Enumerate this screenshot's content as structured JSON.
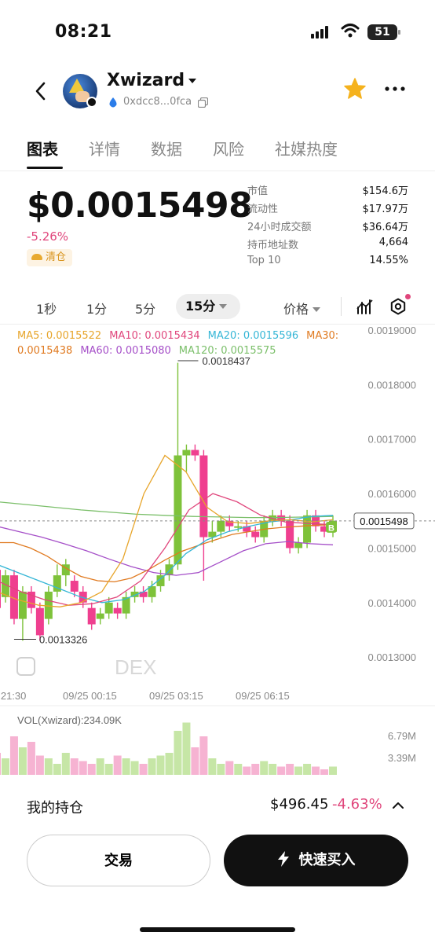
{
  "status_bar": {
    "time": "08:21",
    "battery": "51"
  },
  "header": {
    "token_name": "Xwizard",
    "address": "0xdcc8...0fca"
  },
  "tabs": [
    "图表",
    "详情",
    "数据",
    "风险",
    "社媒热度"
  ],
  "price_section": {
    "price": "$0.0015498",
    "change": "-5.26%",
    "tag": "清仓"
  },
  "stats": [
    {
      "k": "市值",
      "v": "$154.6万"
    },
    {
      "k": "流动性",
      "v": "$17.97万"
    },
    {
      "k": "24小时成交额",
      "v": "$36.64万"
    },
    {
      "k": "持币地址数",
      "v": "4,664"
    },
    {
      "k": "Top 10",
      "v": "14.55%"
    }
  ],
  "intervals": [
    "1秒",
    "1分",
    "5分",
    "15分"
  ],
  "active_interval": "15分",
  "price_type": "价格",
  "ma_legend": {
    "ma5": "MA5: 0.0015522",
    "ma10": "MA10: 0.0015434",
    "ma20": "MA20: 0.0015596",
    "ma30": "MA30:",
    "ma30_val": "0.0015438",
    "ma60": "MA60: 0.0015080",
    "ma120": "MA120: 0.0015575"
  },
  "colors": {
    "up": "#7ec23a",
    "down": "#ef3f8f",
    "ma5": "#e7a52b",
    "ma10": "#e0467c",
    "ma20": "#35b6d6",
    "ma30": "#e07a20",
    "ma60": "#a54fc8",
    "ma120": "#7bbf6a"
  },
  "chart_data": {
    "type": "candlestick",
    "y_ticks": [
      "0.0019000",
      "0.0018000",
      "0.0017000",
      "0.0016000",
      "0.0015000",
      "0.0014000",
      "0.0013000"
    ],
    "y_range": [
      0.00128,
      0.0019
    ],
    "x_ticks": [
      "4 21:30",
      "09/25 00:15",
      "09/25 03:15",
      "09/25 06:15"
    ],
    "high_label": "0.0018437",
    "low_label": "0.0013326",
    "current_price_label": "0.0015498",
    "watermark": "DEX",
    "candles": [
      [
        0.00146,
        0.00139,
        0.00147,
        0.00137
      ],
      [
        0.00141,
        0.00145,
        0.00146,
        0.0014
      ],
      [
        0.00145,
        0.00137,
        0.00146,
        0.00136
      ],
      [
        0.00137,
        0.00142,
        0.00143,
        0.00133
      ],
      [
        0.00142,
        0.00139,
        0.00143,
        0.00138
      ],
      [
        0.00139,
        0.00134,
        0.0014,
        0.00133
      ],
      [
        0.00137,
        0.00142,
        0.00143,
        0.00136
      ],
      [
        0.00142,
        0.00145,
        0.00147,
        0.00141
      ],
      [
        0.00145,
        0.00147,
        0.00148,
        0.00143
      ],
      [
        0.00144,
        0.00142,
        0.00145,
        0.00141
      ],
      [
        0.00142,
        0.0014,
        0.00143,
        0.00139
      ],
      [
        0.00139,
        0.00136,
        0.0014,
        0.00135
      ],
      [
        0.00137,
        0.00138,
        0.00139,
        0.00136
      ],
      [
        0.00138,
        0.0014,
        0.00141,
        0.00137
      ],
      [
        0.00139,
        0.00138,
        0.0014,
        0.00137
      ],
      [
        0.00138,
        0.00141,
        0.00142,
        0.00137
      ],
      [
        0.00141,
        0.00142,
        0.00143,
        0.0014
      ],
      [
        0.00142,
        0.00141,
        0.00143,
        0.0014
      ],
      [
        0.00141,
        0.00143,
        0.00144,
        0.0014
      ],
      [
        0.00143,
        0.00145,
        0.00146,
        0.00142
      ],
      [
        0.00145,
        0.00147,
        0.00148,
        0.00144
      ],
      [
        0.00147,
        0.00167,
        0.00184,
        0.00146
      ],
      [
        0.00167,
        0.00168,
        0.00169,
        0.00164
      ],
      [
        0.00168,
        0.00167,
        0.00169,
        0.00166
      ],
      [
        0.00167,
        0.00152,
        0.00168,
        0.00144
      ],
      [
        0.00152,
        0.00153,
        0.00155,
        0.00151
      ],
      [
        0.00153,
        0.00155,
        0.00156,
        0.00152
      ],
      [
        0.00155,
        0.00154,
        0.00156,
        0.00153
      ],
      [
        0.00154,
        0.00154,
        0.00155,
        0.00153
      ],
      [
        0.00154,
        0.00153,
        0.00155,
        0.00152
      ],
      [
        0.00153,
        0.00152,
        0.00154,
        0.00151
      ],
      [
        0.00152,
        0.00155,
        0.00156,
        0.00151
      ],
      [
        0.00155,
        0.00156,
        0.00157,
        0.00154
      ],
      [
        0.00156,
        0.00155,
        0.00157,
        0.00154
      ],
      [
        0.00155,
        0.0015,
        0.00156,
        0.00149
      ],
      [
        0.0015,
        0.00151,
        0.00152,
        0.00149
      ],
      [
        0.00151,
        0.00156,
        0.00157,
        0.0015
      ],
      [
        0.00156,
        0.00154,
        0.00157,
        0.00153
      ],
      [
        0.00154,
        0.00153,
        0.00155,
        0.00152
      ],
      [
        0.00153,
        0.00155,
        0.00156,
        0.00152
      ]
    ],
    "ma120": [
      0.001585,
      0.00158,
      0.001575,
      0.00157,
      0.001566,
      0.001562,
      0.00156,
      0.001558,
      0.001557,
      0.001556,
      0.001556,
      0.001557,
      0.001558
    ],
    "ma60": [
      0.00154,
      0.00153,
      0.00152,
      0.001508,
      0.001495,
      0.00148,
      0.001466,
      0.001455,
      0.00145,
      0.001455,
      0.001475,
      0.001495,
      0.001508,
      0.001512,
      0.001508,
      0.001506
    ],
    "ma30": [
      0.00151,
      0.00151,
      0.0015,
      0.001485,
      0.001465,
      0.001448,
      0.00144,
      0.001438,
      0.001445,
      0.00146,
      0.001478,
      0.001494,
      0.001505,
      0.001515,
      0.001525,
      0.00153,
      0.001535,
      0.001538,
      0.00154,
      0.001542,
      0.001543
    ],
    "ma20": [
      0.00147,
      0.001455,
      0.00144,
      0.001425,
      0.00141,
      0.0014,
      0.001405,
      0.00142,
      0.00145,
      0.00149,
      0.001515,
      0.00153,
      0.00154,
      0.001548,
      0.001552,
      0.001558,
      0.00156
    ],
    "ma10": [
      0.00144,
      0.00142,
      0.001405,
      0.001395,
      0.001398,
      0.00141,
      0.00144,
      0.0015,
      0.00157,
      0.0016,
      0.001585,
      0.00156,
      0.001548,
      0.001545,
      0.001543
    ],
    "ma5": [
      0.00142,
      0.001405,
      0.001395,
      0.001392,
      0.0014,
      0.00142,
      0.00148,
      0.0016,
      0.00167,
      0.00164,
      0.001575,
      0.001548,
      0.001545,
      0.00155,
      0.001552,
      0.001548,
      0.001552
    ],
    "volume_label": "VOL(Xwizard):234.09K",
    "volume_ticks": [
      "6.79M",
      "3.39M"
    ],
    "volumes": [
      0.4,
      0.3,
      0.7,
      0.5,
      0.6,
      0.35,
      0.3,
      0.2,
      0.4,
      0.3,
      0.25,
      0.2,
      0.3,
      0.2,
      0.35,
      0.3,
      0.25,
      0.2,
      0.3,
      0.35,
      0.4,
      0.8,
      0.95,
      0.5,
      0.7,
      0.3,
      0.2,
      0.25,
      0.2,
      0.15,
      0.2,
      0.25,
      0.2,
      0.15,
      0.2,
      0.15,
      0.2,
      0.15,
      0.1,
      0.15
    ]
  },
  "holdings": {
    "label": "我的持仓",
    "value": "$496.45",
    "change": "-4.63%"
  },
  "buttons": {
    "trade": "交易",
    "quick_buy": "快速买入"
  }
}
